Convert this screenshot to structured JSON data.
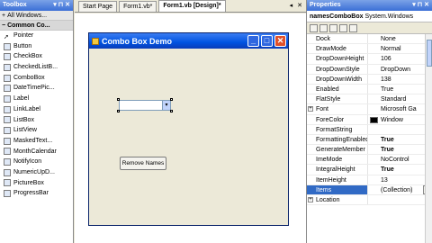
{
  "toolbox": {
    "title": "Toolbox",
    "pin": "▾ ⊓ ✕",
    "groups": [
      "All Windows...",
      "Common Co..."
    ],
    "items": [
      "Pointer",
      "Button",
      "CheckBox",
      "CheckedListB...",
      "ComboBox",
      "DateTimePic...",
      "Label",
      "LinkLabel",
      "ListBox",
      "ListView",
      "MaskedText...",
      "MonthCalendar",
      "NotifyIcon",
      "NumericUpD...",
      "PictureBox",
      "ProgressBar"
    ]
  },
  "tabs": [
    {
      "label": "Start Page"
    },
    {
      "label": "Form1.vb*"
    },
    {
      "label": "Form1.vb [Design]*"
    }
  ],
  "tab_controls": {
    "arrow": "◂",
    "close": "✕"
  },
  "form": {
    "title": "Combo Box Demo",
    "minimize": "_",
    "maximize": "□",
    "close": "✕",
    "combo_arrow": "▾",
    "remove_button": "Remove Names"
  },
  "properties": {
    "title": "Properties",
    "object_name": "namesComboBox",
    "object_type": "System.Windows",
    "rows": [
      {
        "name": "Dock",
        "value": "None"
      },
      {
        "name": "DrawMode",
        "value": "Normal"
      },
      {
        "name": "DropDownHeight",
        "value": "106"
      },
      {
        "name": "DropDownStyle",
        "value": "DropDown"
      },
      {
        "name": "DropDownWidth",
        "value": "138"
      },
      {
        "name": "Enabled",
        "value": "True"
      },
      {
        "name": "FlatStyle",
        "value": "Standard"
      },
      {
        "name": "Font",
        "value": "Microsoft Ga"
      },
      {
        "name": "ForeColor",
        "value": "Window"
      },
      {
        "name": "FormatString",
        "value": ""
      },
      {
        "name": "FormattingEnabled",
        "value": "True"
      },
      {
        "name": "GenerateMember",
        "value": "True"
      },
      {
        "name": "ImeMode",
        "value": "NoControl"
      },
      {
        "name": "IntegralHeight",
        "value": "True"
      },
      {
        "name": "ItemHeight",
        "value": "13"
      },
      {
        "name": "Items",
        "value": "(Collection)"
      },
      {
        "name": "Location",
        "value": ""
      }
    ],
    "ellipsis": "..."
  },
  "colors": {
    "titlebar": "#3b6fd6",
    "selection": "#316ac5",
    "form_title": "#0053e1"
  }
}
